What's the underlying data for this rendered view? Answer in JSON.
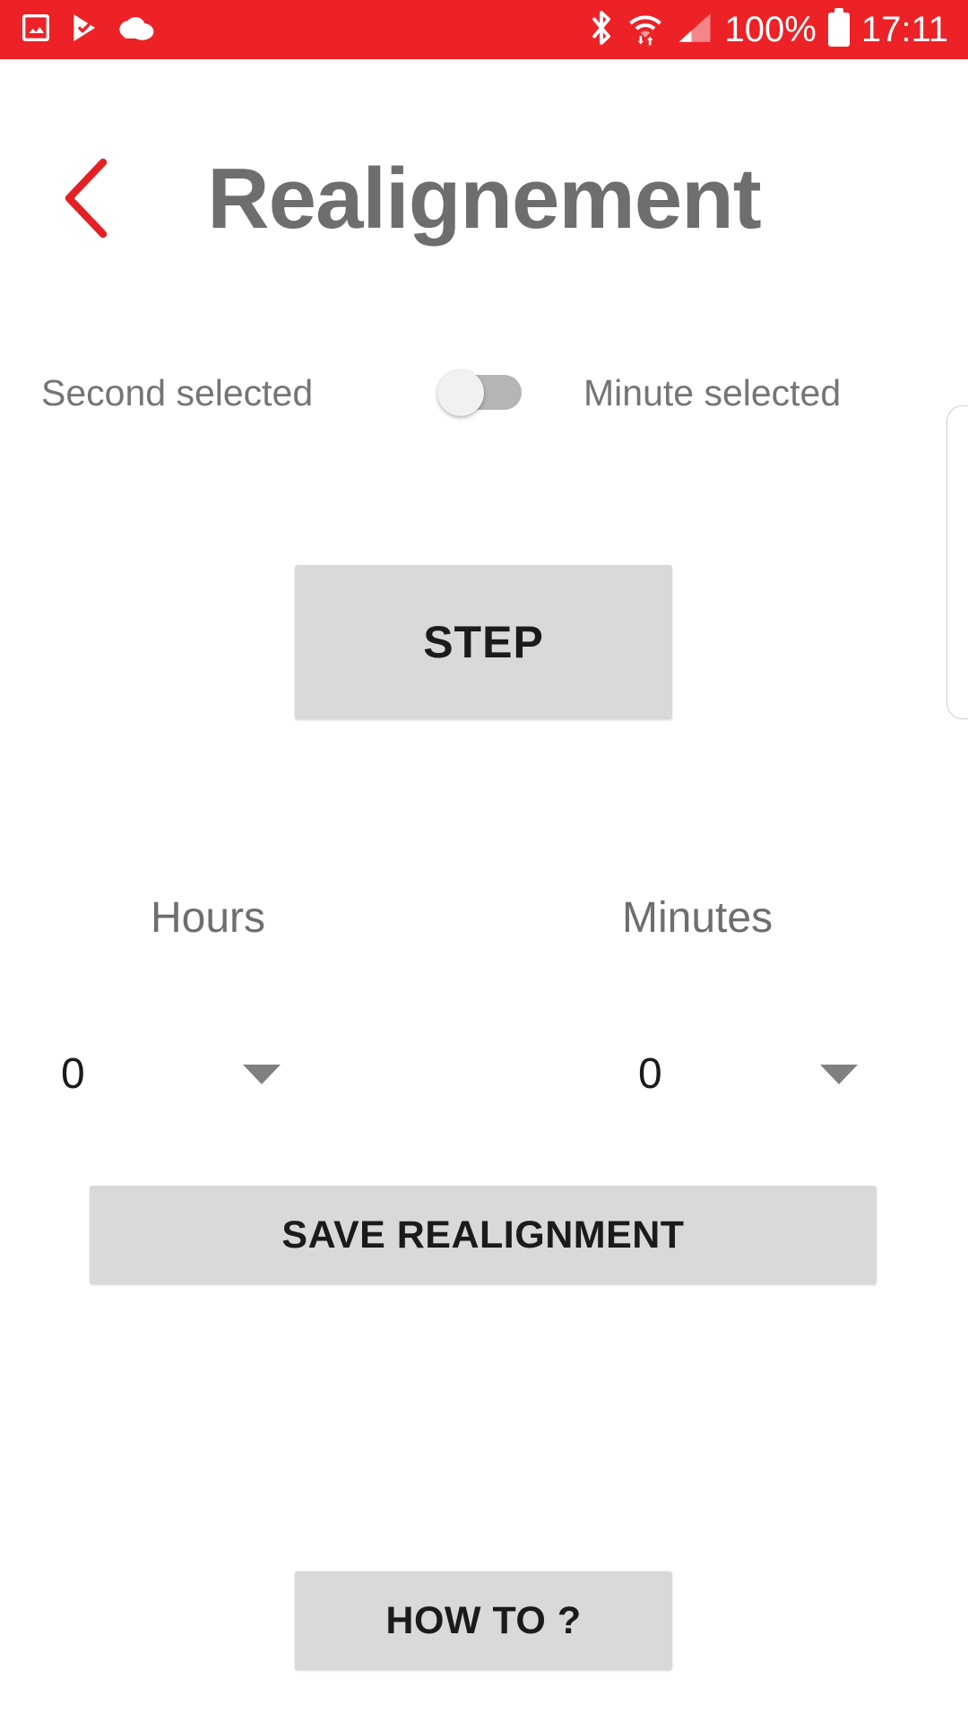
{
  "statusbar": {
    "background_color": "#ec2227",
    "foreground_color": "#ffffff",
    "notification_icons": [
      "image-icon",
      "play-check-icon",
      "cloud-icon"
    ],
    "system_icons": [
      "bluetooth-icon",
      "wifi-transfer-icon",
      "signal-icon",
      "battery-icon"
    ],
    "battery_percent": "100%",
    "clock": "17:11"
  },
  "header": {
    "back_label": "back-chevron",
    "title": "Realignement",
    "title_color": "#6e6e6e",
    "accent_color": "#e32125"
  },
  "mode_toggle": {
    "left_label": "Second selected",
    "right_label": "Minute selected",
    "state": "off",
    "track_color": "#b5b5b5",
    "thumb_color": "#f1f1f1"
  },
  "step": {
    "label": "STEP"
  },
  "time_fields": [
    {
      "label": "Hours",
      "value": "0",
      "caret": "chevron-down-icon"
    },
    {
      "label": "Minutes",
      "value": "0",
      "caret": "chevron-down-icon"
    }
  ],
  "actions": {
    "save_label": "SAVE REALIGNMENT",
    "howto_label": "HOW TO ?",
    "button_color": "#d9d9d9",
    "button_text_color": "#1b1b1b"
  }
}
